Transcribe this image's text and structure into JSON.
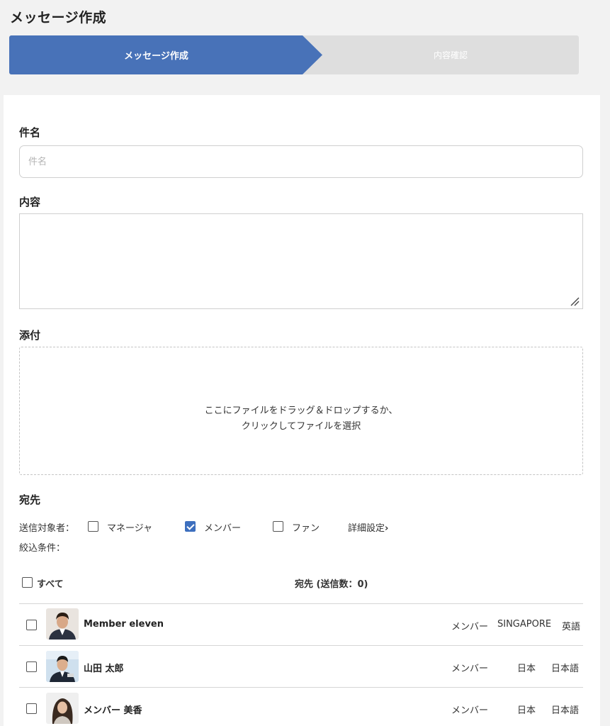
{
  "page": {
    "title": "メッセージ作成"
  },
  "steps": [
    {
      "label": "メッセージ作成",
      "active": true
    },
    {
      "label": "内容確認",
      "active": false
    }
  ],
  "form": {
    "subject": {
      "label": "件名",
      "placeholder": "件名",
      "value": ""
    },
    "content": {
      "label": "内容",
      "value": ""
    },
    "attachment": {
      "label": "添付",
      "drop_line1": "ここにファイルをドラッグ＆ドロップするか、",
      "drop_line2": "クリックしてファイルを選択"
    }
  },
  "recipients": {
    "label": "宛先",
    "target_label": "送信対象者：",
    "targets": [
      {
        "label": "マネージャ",
        "checked": false
      },
      {
        "label": "メンバー",
        "checked": true
      },
      {
        "label": "ファン",
        "checked": false
      }
    ],
    "detail_link": "詳細設定",
    "detail_icon": "chevron-right-icon",
    "filter_label": "絞込条件：",
    "select_all_label": "すべて",
    "count_label": "宛先 (送信数：0)",
    "rows": [
      {
        "name": "Member eleven",
        "role": "メンバー",
        "region": "SINGAPORE",
        "language": "英語",
        "checked": false
      },
      {
        "name": "山田 太郎",
        "role": "メンバー",
        "region": "日本",
        "language": "日本語",
        "checked": false
      },
      {
        "name": "メンバー 美香",
        "role": "メンバー",
        "region": "日本",
        "language": "日本語",
        "checked": false
      }
    ]
  },
  "colors": {
    "accent": "#4872b8",
    "step_inactive": "#dedede",
    "checkbox_checked": "#3d6fbe"
  }
}
